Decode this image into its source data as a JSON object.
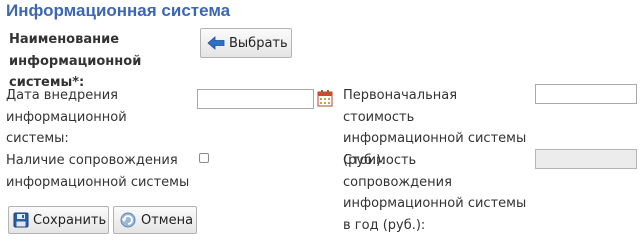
{
  "page": {
    "title": "Информационная система"
  },
  "form": {
    "name_label": "Наименование информационной системы*:",
    "select_button_label": "Выбрать",
    "date_label": "Дата внедрения информационной системы:",
    "date_value": "",
    "initial_cost_label": "Первоначальная стоимость информационной системы (руб.):",
    "initial_cost_value": "",
    "support_label": "Наличие сопровождения информационной системы",
    "support_checked": false,
    "support_cost_label": "Стоимость сопровождения информационной системы в год (руб.):",
    "support_cost_value": ""
  },
  "actions": {
    "save_label": "Сохранить",
    "cancel_label": "Отмена"
  },
  "icons": {
    "select": "arrow-left-icon",
    "date": "calendar-icon",
    "save": "floppy-disk-icon",
    "cancel": "undo-icon"
  },
  "colors": {
    "title": "#3c67b1",
    "icon_blue": "#2f6fc4",
    "calendar_red": "#d9452b"
  }
}
